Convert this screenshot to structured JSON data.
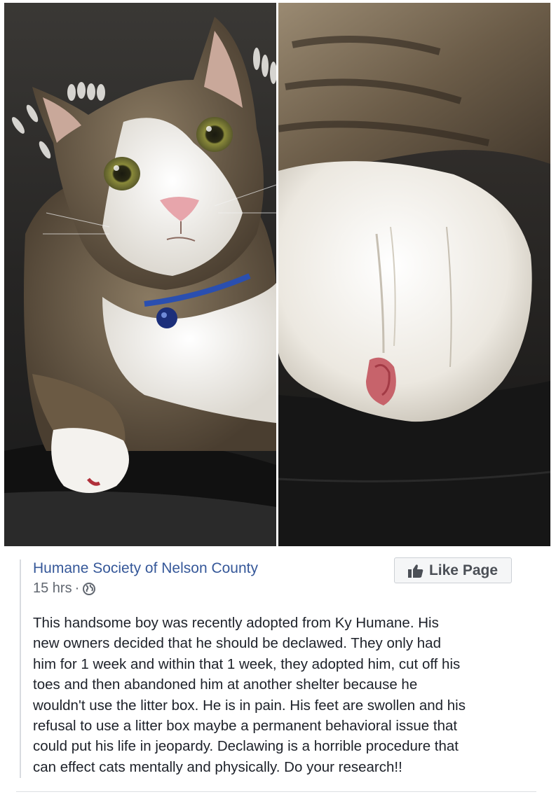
{
  "photos": [
    {
      "name": "cat-face-photo"
    },
    {
      "name": "cat-paw-photo"
    }
  ],
  "post": {
    "page_name": "Humane Society of Nelson County",
    "timestamp": "15 hrs",
    "separator": "·",
    "privacy_icon": "globe-icon",
    "like_button": {
      "label": "Like Page",
      "icon": "thumbs-up-icon"
    },
    "text_lines": [
      "This handsome boy was recently adopted from Ky Humane. His",
      "new owners decided that he should be declawed. They only had",
      "him for 1 week and within that 1 week, they adopted him, cut off his",
      "toes and then abandoned him at another shelter because he",
      "wouldn't use the litter box. He is in pain. His feet are swollen and his",
      "refusal to use a litter box maybe a permanent behavioral issue that",
      "could put his life in jeopardy. Declawing is a horrible procedure that",
      "can effect cats mentally and physically. Do your research!!"
    ]
  },
  "colors": {
    "link": "#365899",
    "meta": "#616770",
    "text": "#1d2129",
    "button_bg": "#f5f6f7",
    "button_text": "#4b4f56"
  }
}
